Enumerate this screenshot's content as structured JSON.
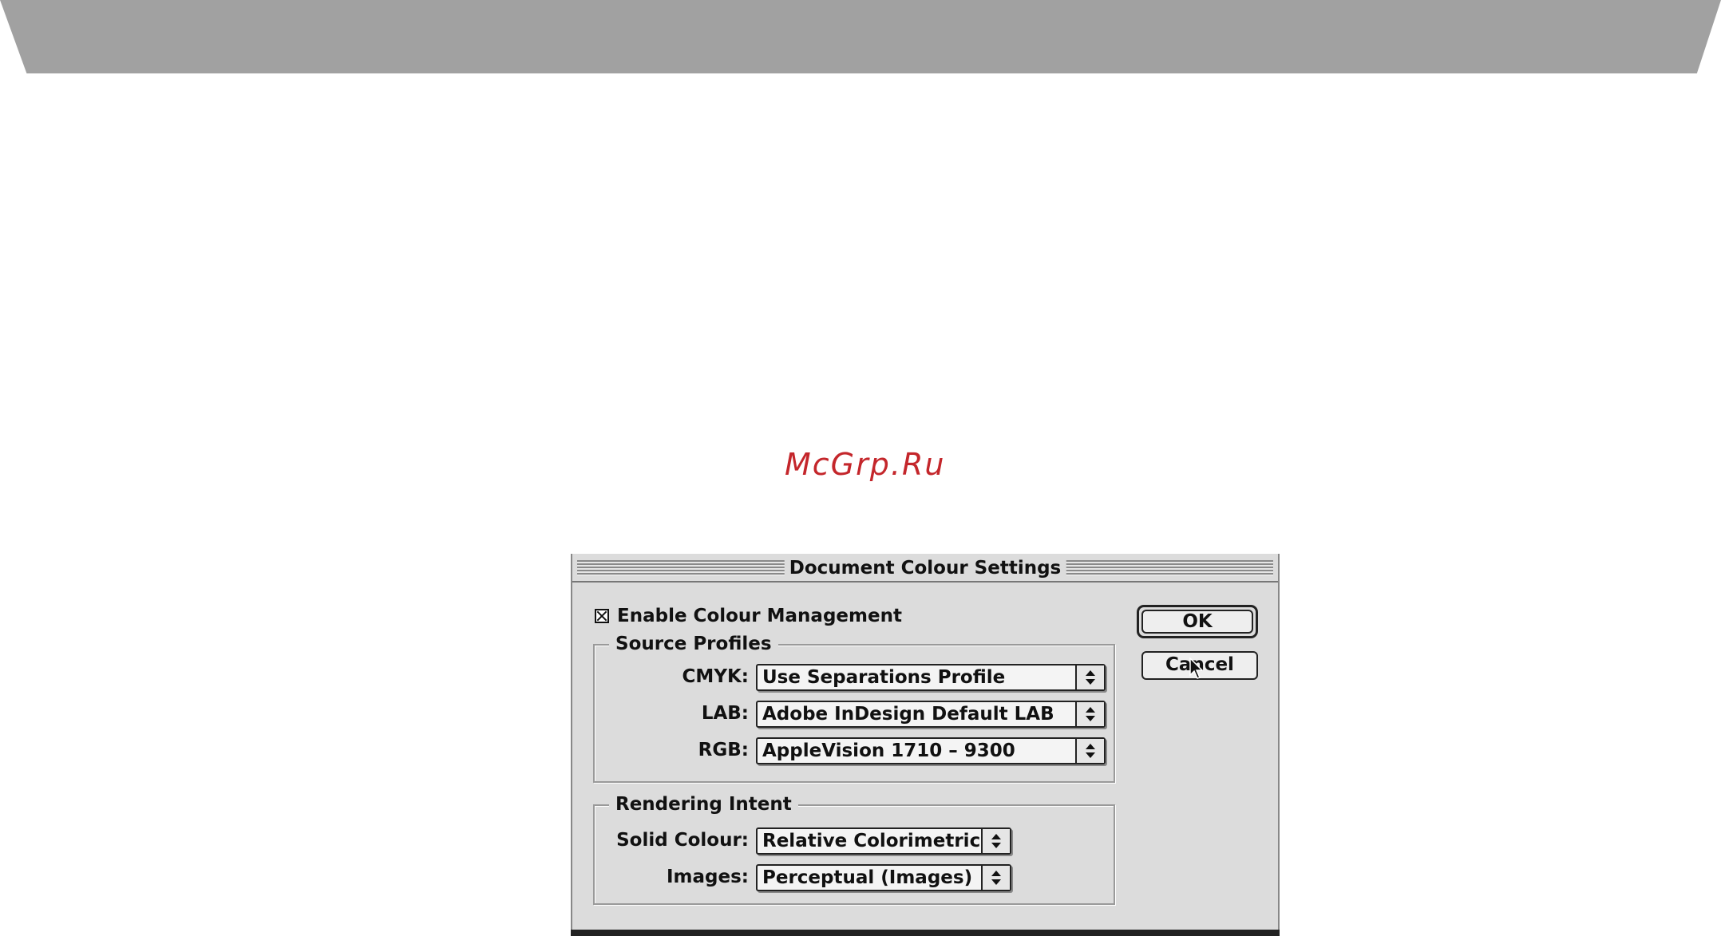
{
  "watermark": "McGrp.Ru",
  "dialog": {
    "title": "Document Colour Settings",
    "enable_label": "Enable Colour Management",
    "enable_checked": true,
    "source_profiles": {
      "title": "Source Profiles",
      "cmyk_label": "CMYK:",
      "cmyk_value": "Use Separations Profile",
      "lab_label": "LAB:",
      "lab_value": "Adobe InDesign Default LAB",
      "rgb_label": "RGB:",
      "rgb_value": "AppleVision 1710 – 9300"
    },
    "rendering_intent": {
      "title": "Rendering Intent",
      "solid_label": "Solid Colour:",
      "solid_value": "Relative Colorimetric",
      "images_label": "Images:",
      "images_value": "Perceptual (Images)"
    },
    "ok_label": "OK",
    "cancel_label": "Cancel"
  },
  "colors": {
    "dialog_bg": "#dcdcdc",
    "banner": "#a1a1a1",
    "watermark": "#c4262b"
  }
}
